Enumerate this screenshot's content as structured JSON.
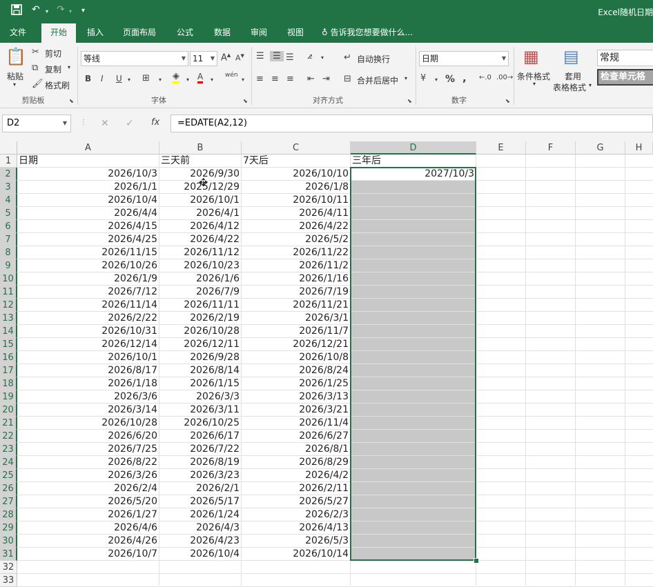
{
  "titlebar": {
    "title": "Excel随机日期",
    "save_icon": "save-icon",
    "undo_icon": "undo-icon",
    "redo_icon": "redo-icon"
  },
  "tabs": [
    "文件",
    "开始",
    "插入",
    "页面布局",
    "公式",
    "数据",
    "审阅",
    "视图"
  ],
  "tell_me": "告诉我您想要做什么...",
  "ribbon": {
    "clipboard": {
      "paste": "粘贴",
      "cut": "剪切",
      "copy": "复制",
      "format_painter": "格式刷",
      "label": "剪贴板"
    },
    "font": {
      "name": "等线",
      "size": "11",
      "label": "字体",
      "bold": "B",
      "italic": "I",
      "underline": "U",
      "phonetic": "wén"
    },
    "alignment": {
      "wrap": "自动换行",
      "merge": "合并后居中",
      "label": "对齐方式"
    },
    "number": {
      "format": "日期",
      "percent": "%",
      "comma": ",",
      "label": "数字"
    },
    "styles": {
      "conditional": "条件格式",
      "table_fmt_1": "套用",
      "table_fmt_2": "表格格式",
      "style_normal": "常规",
      "style_check": "检查单元格"
    }
  },
  "formula_bar": {
    "name_box": "D2",
    "formula": "=EDATE(A2,12)",
    "cancel": "✕",
    "enter": "✓",
    "fx": "fx"
  },
  "columns": [
    "A",
    "B",
    "C",
    "D",
    "E",
    "F",
    "G",
    "H"
  ],
  "header_row": [
    "日期",
    "三天前",
    "7天后",
    "三年后"
  ],
  "rows": [
    [
      "2026/10/3",
      "2026/9/30",
      "2026/10/10",
      "2027/10/3"
    ],
    [
      "2026/1/1",
      "2025/12/29",
      "2026/1/8",
      ""
    ],
    [
      "2026/10/4",
      "2026/10/1",
      "2026/10/11",
      ""
    ],
    [
      "2026/4/4",
      "2026/4/1",
      "2026/4/11",
      ""
    ],
    [
      "2026/4/15",
      "2026/4/12",
      "2026/4/22",
      ""
    ],
    [
      "2026/4/25",
      "2026/4/22",
      "2026/5/2",
      ""
    ],
    [
      "2026/11/15",
      "2026/11/12",
      "2026/11/22",
      ""
    ],
    [
      "2026/10/26",
      "2026/10/23",
      "2026/11/2",
      ""
    ],
    [
      "2026/1/9",
      "2026/1/6",
      "2026/1/16",
      ""
    ],
    [
      "2026/7/12",
      "2026/7/9",
      "2026/7/19",
      ""
    ],
    [
      "2026/11/14",
      "2026/11/11",
      "2026/11/21",
      ""
    ],
    [
      "2026/2/22",
      "2026/2/19",
      "2026/3/1",
      ""
    ],
    [
      "2026/10/31",
      "2026/10/28",
      "2026/11/7",
      ""
    ],
    [
      "2026/12/14",
      "2026/12/11",
      "2026/12/21",
      ""
    ],
    [
      "2026/10/1",
      "2026/9/28",
      "2026/10/8",
      ""
    ],
    [
      "2026/8/17",
      "2026/8/14",
      "2026/8/24",
      ""
    ],
    [
      "2026/1/18",
      "2026/1/15",
      "2026/1/25",
      ""
    ],
    [
      "2026/3/6",
      "2026/3/3",
      "2026/3/13",
      ""
    ],
    [
      "2026/3/14",
      "2026/3/11",
      "2026/3/21",
      ""
    ],
    [
      "2026/10/28",
      "2026/10/25",
      "2026/11/4",
      ""
    ],
    [
      "2026/6/20",
      "2026/6/17",
      "2026/6/27",
      ""
    ],
    [
      "2026/7/25",
      "2026/7/22",
      "2026/8/1",
      ""
    ],
    [
      "2026/8/22",
      "2026/8/19",
      "2026/8/29",
      ""
    ],
    [
      "2026/3/26",
      "2026/3/23",
      "2026/4/2",
      ""
    ],
    [
      "2026/2/4",
      "2026/2/1",
      "2026/2/11",
      ""
    ],
    [
      "2026/5/20",
      "2026/5/17",
      "2026/5/27",
      ""
    ],
    [
      "2026/1/27",
      "2026/1/24",
      "2026/2/3",
      ""
    ],
    [
      "2026/4/6",
      "2026/4/3",
      "2026/4/13",
      ""
    ],
    [
      "2026/4/26",
      "2026/4/23",
      "2026/5/3",
      ""
    ],
    [
      "2026/10/7",
      "2026/10/4",
      "2026/10/14",
      ""
    ]
  ],
  "row_numbers": [
    "1",
    "2",
    "3",
    "4",
    "5",
    "6",
    "7",
    "8",
    "9",
    "10",
    "11",
    "12",
    "13",
    "14",
    "15",
    "16",
    "17",
    "18",
    "19",
    "20",
    "21",
    "22",
    "23",
    "24",
    "25",
    "26",
    "27",
    "28",
    "29",
    "30",
    "31",
    "32",
    "33"
  ],
  "colors": {
    "excel_green": "#217346",
    "selection_gray": "#c8c8c8"
  }
}
